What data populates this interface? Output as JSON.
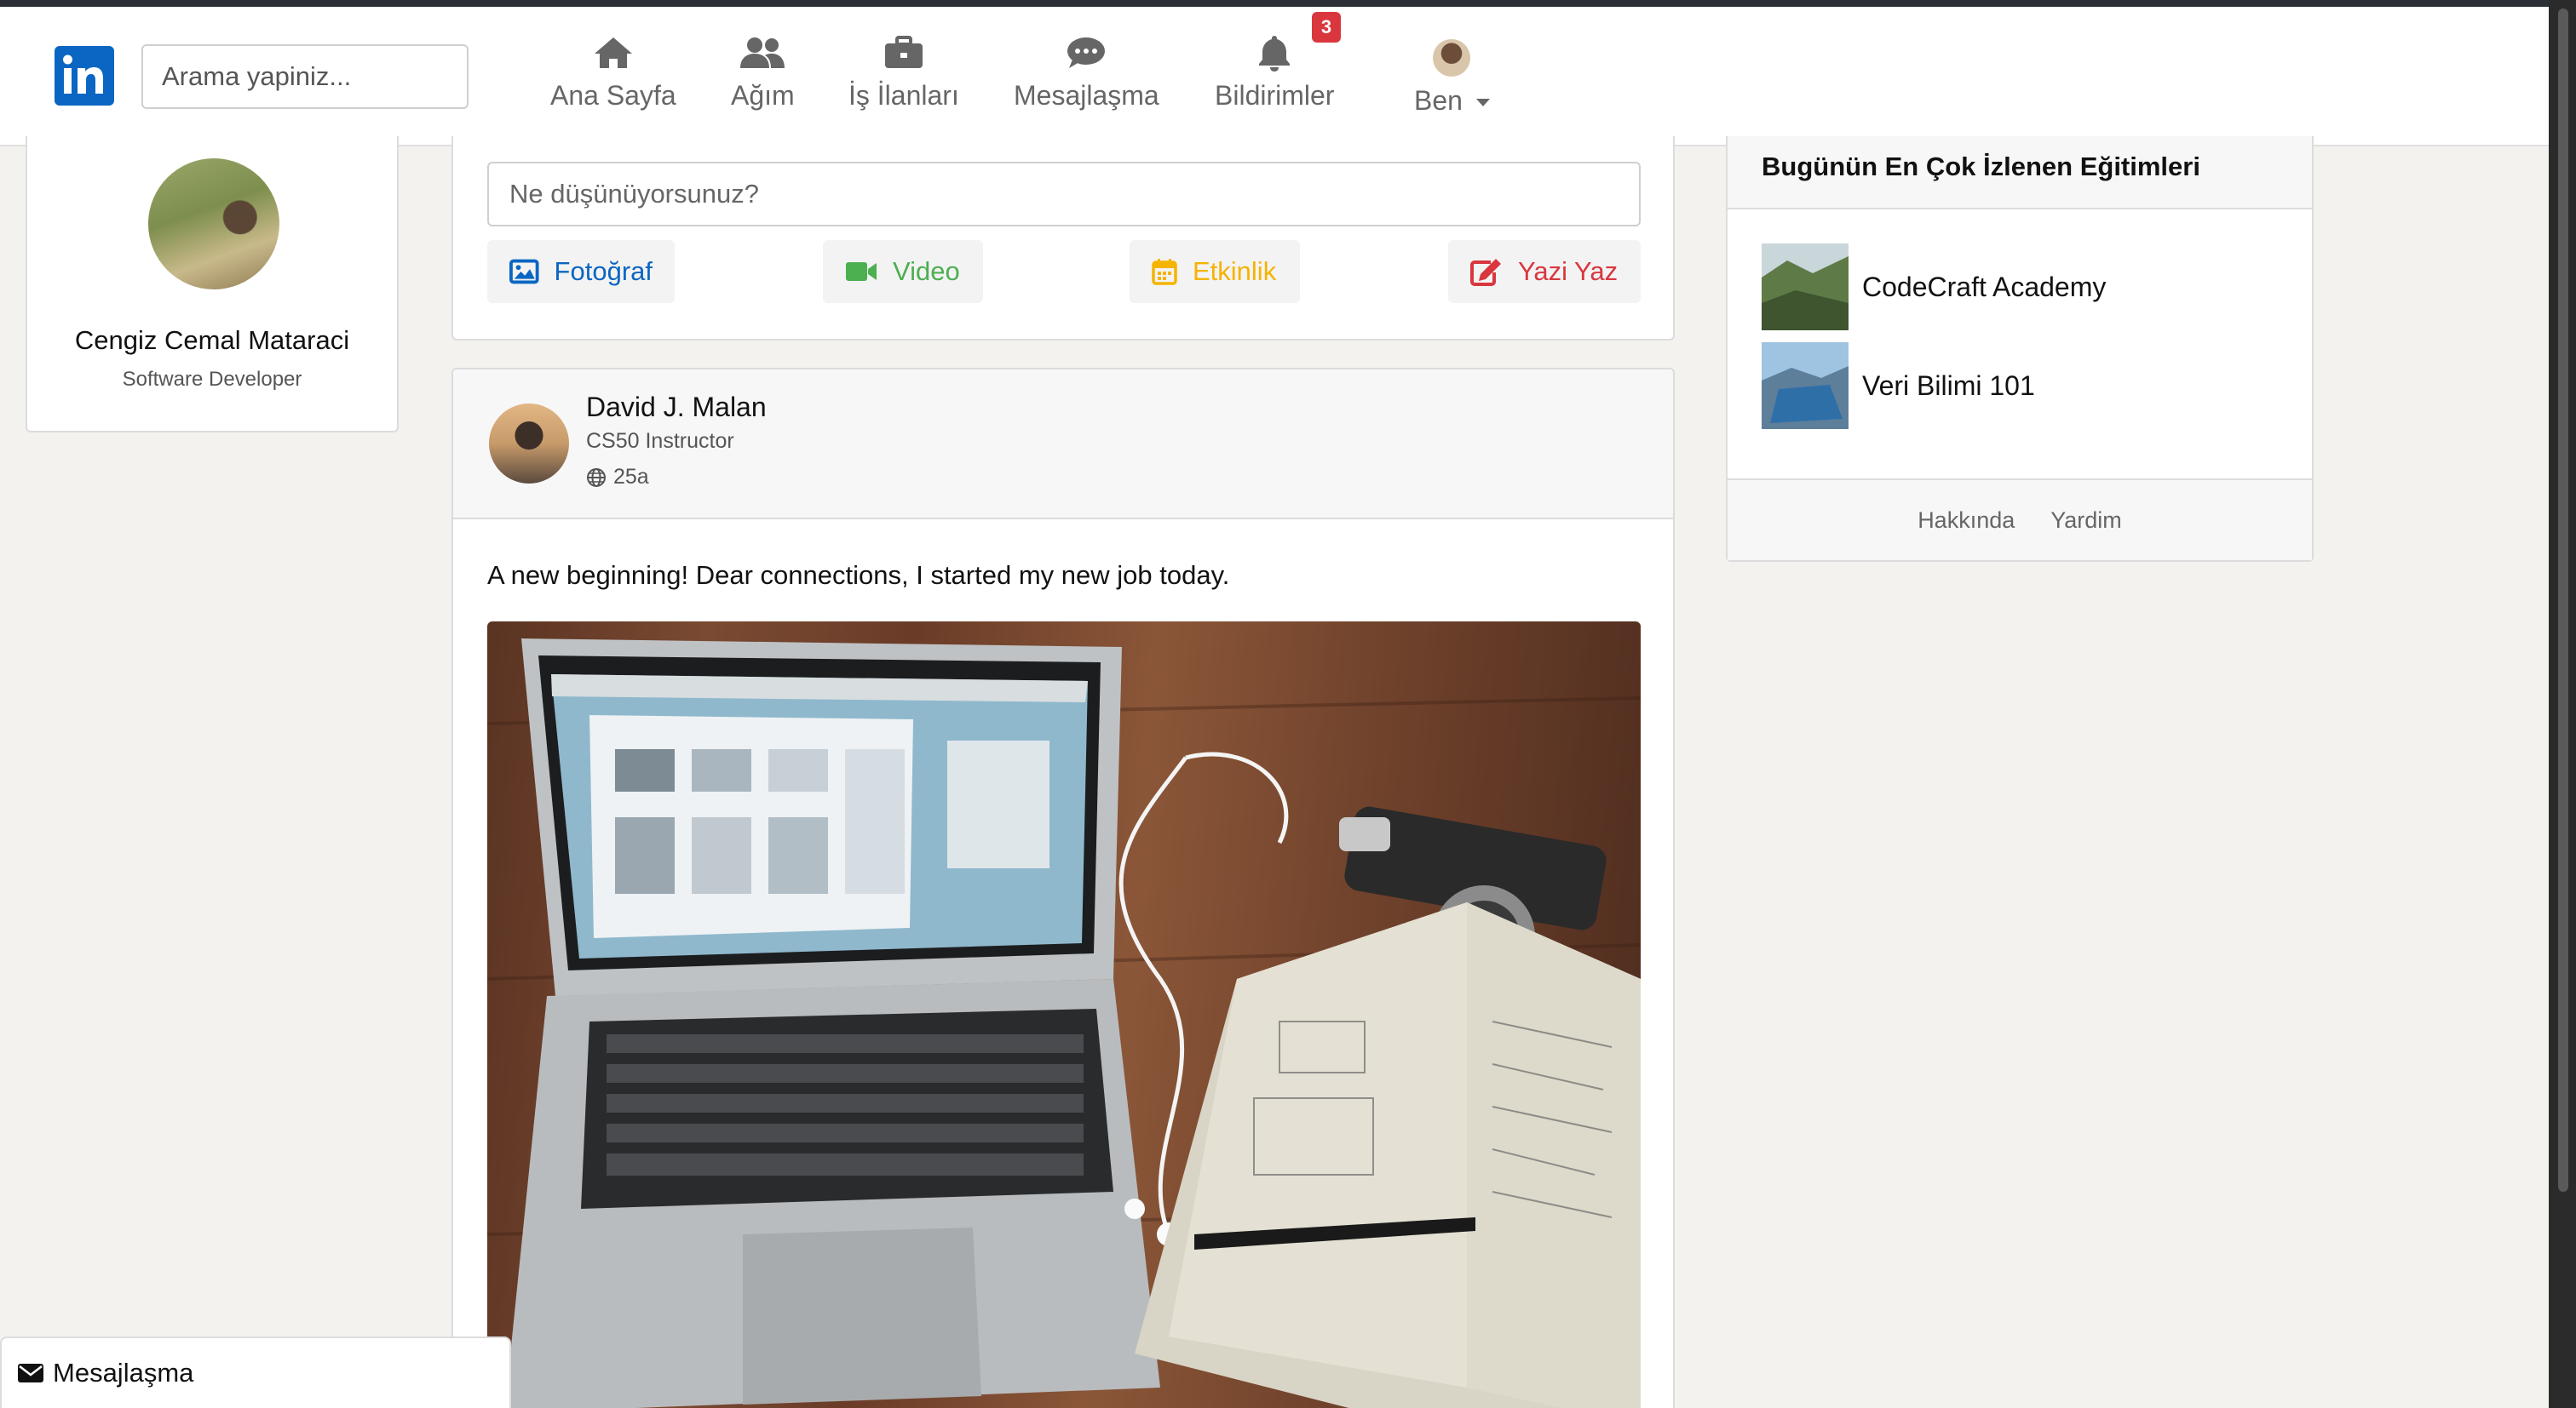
{
  "app": {
    "logo_text": "in",
    "brand_color": "#0a66c2"
  },
  "nav": {
    "search_placeholder": "Arama yapiniz...",
    "items": [
      {
        "label": "Ana Sayfa",
        "icon": "home-icon"
      },
      {
        "label": "Ağım",
        "icon": "network-icon"
      },
      {
        "label": "İş İlanları",
        "icon": "briefcase-icon"
      },
      {
        "label": "Mesajlaşma",
        "icon": "chat-icon"
      },
      {
        "label": "Bildirimler",
        "icon": "bell-icon"
      }
    ],
    "notification_count": "3",
    "me_label": "Ben"
  },
  "profile": {
    "name": "Cengiz Cemal Mataraci",
    "title": "Software Developer"
  },
  "composer": {
    "placeholder": "Ne düşünüyorsunuz?",
    "actions": [
      {
        "label": "Fotoğraf",
        "icon": "image-icon",
        "color": "#0a66c2"
      },
      {
        "label": "Video",
        "icon": "video-icon",
        "color": "#4caf50"
      },
      {
        "label": "Etkinlik",
        "icon": "calendar-icon",
        "color": "#f5b400"
      },
      {
        "label": "Yazi Yaz",
        "icon": "edit-icon",
        "color": "#d9363e"
      }
    ]
  },
  "post": {
    "author": "David J. Malan",
    "role": "CS50 Instructor",
    "time": "25a",
    "text": "A new beginning! Dear connections, I started my new job today."
  },
  "sidebar": {
    "title": "Bugünün En Çok İzlenen Eğitimleri",
    "courses": [
      {
        "label": "CodeCraft Academy"
      },
      {
        "label": "Veri Bilimi 101"
      }
    ],
    "footer_links": [
      "Hakkında",
      "Yardim"
    ]
  },
  "messaging_bar": {
    "label": "Mesajlaşma"
  }
}
